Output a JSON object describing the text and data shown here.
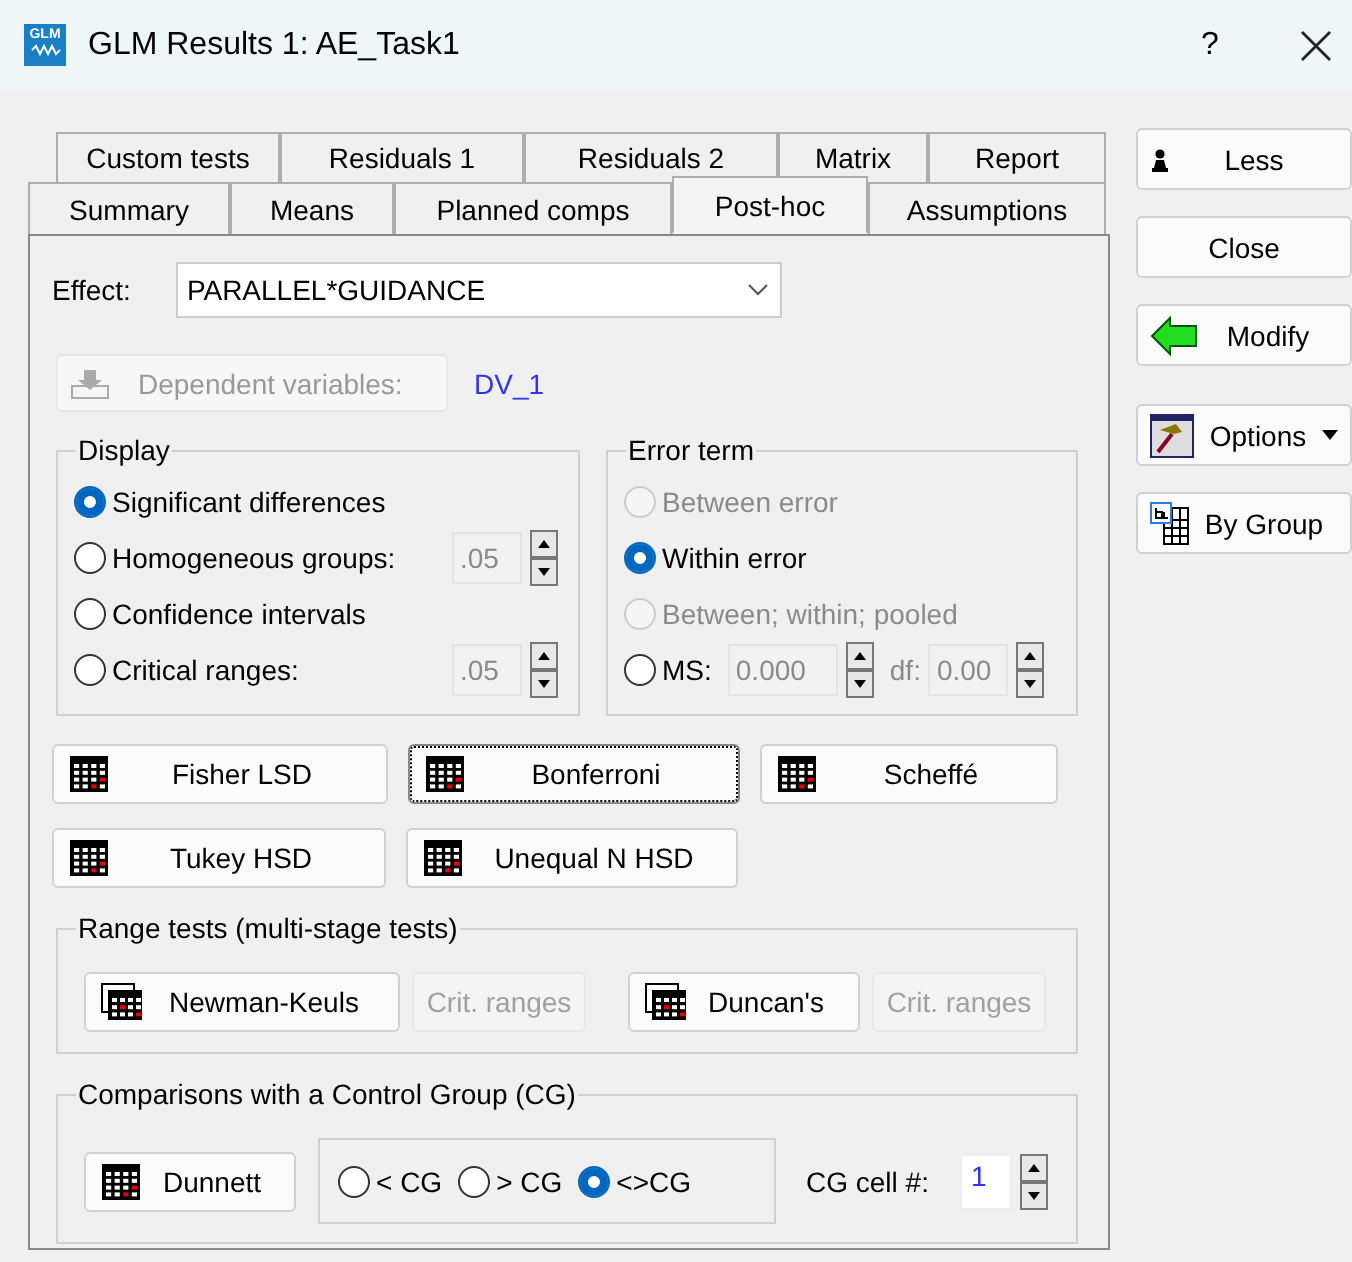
{
  "window": {
    "title": "GLM Results 1: AE_Task1",
    "app_icon_text": "GLM",
    "help": "?"
  },
  "tab_rows": [
    {
      "tabs": [
        {
          "label": "Custom tests",
          "selected": false
        },
        {
          "label": "Residuals 1",
          "selected": false
        },
        {
          "label": "Residuals 2",
          "selected": false
        },
        {
          "label": "Matrix",
          "selected": false
        },
        {
          "label": "Report",
          "selected": false
        }
      ]
    },
    {
      "tabs": [
        {
          "label": "Summary",
          "selected": false
        },
        {
          "label": "Means",
          "selected": false
        },
        {
          "label": "Planned comps",
          "selected": false
        },
        {
          "label": "Post-hoc",
          "selected": true
        },
        {
          "label": "Assumptions",
          "selected": false
        }
      ]
    }
  ],
  "effect": {
    "label": "Effect:",
    "value": "PARALLEL*GUIDANCE"
  },
  "dependent": {
    "button": "Dependent variables:",
    "disabled": true,
    "value": "DV_1"
  },
  "display": {
    "title": "Display",
    "options": [
      {
        "label": "Significant differences",
        "selected": true
      },
      {
        "label": "Homogeneous groups:",
        "selected": false,
        "field": ".05"
      },
      {
        "label": "Confidence intervals",
        "selected": false
      },
      {
        "label": "Critical ranges:",
        "selected": false,
        "field": ".05"
      }
    ]
  },
  "error_term": {
    "title": "Error term",
    "options": [
      {
        "label": "Between error",
        "selected": false,
        "disabled": true
      },
      {
        "label": "Within error",
        "selected": true,
        "disabled": false
      },
      {
        "label": "Between; within; pooled",
        "selected": false,
        "disabled": true
      },
      {
        "label": "MS:",
        "selected": false,
        "disabled": false,
        "ms": "0.000",
        "df_label": "df:",
        "df": "0.00"
      }
    ]
  },
  "test_buttons": [
    {
      "label": "Fisher LSD",
      "focused": false
    },
    {
      "label": "Bonferroni",
      "focused": true
    },
    {
      "label": "Scheffé",
      "focused": false
    },
    {
      "label": "Tukey HSD",
      "focused": false
    },
    {
      "label": "Unequal N HSD",
      "focused": false
    }
  ],
  "range_tests": {
    "title": "Range tests (multi-stage tests)",
    "items": [
      {
        "label": "Newman-Keuls",
        "crit": "Crit. ranges",
        "crit_disabled": true
      },
      {
        "label": "Duncan's",
        "crit": "Crit. ranges",
        "crit_disabled": true
      }
    ]
  },
  "control_group": {
    "title": "Comparisons with a Control Group (CG)",
    "button": "Dunnett",
    "options": [
      {
        "label": "< CG",
        "selected": false
      },
      {
        "label": "> CG",
        "selected": false
      },
      {
        "label": "<>CG",
        "selected": true
      }
    ],
    "cell_label": "CG cell #:",
    "cell_value": "1"
  },
  "side_buttons": [
    {
      "kind": "less",
      "label": "Less"
    },
    {
      "kind": "plain",
      "label": "Close"
    },
    {
      "kind": "modify",
      "label": "Modify"
    },
    {
      "kind": "options",
      "label": "Options"
    },
    {
      "kind": "bygroup",
      "label": "By Group"
    }
  ]
}
